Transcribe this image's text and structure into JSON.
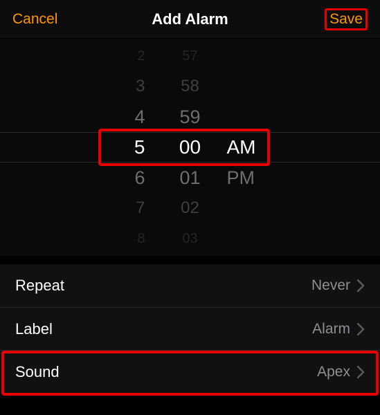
{
  "header": {
    "cancel": "Cancel",
    "title": "Add Alarm",
    "save": "Save"
  },
  "picker": {
    "hours": [
      "2",
      "3",
      "4",
      "5",
      "6",
      "7",
      "8"
    ],
    "minutes": [
      "57",
      "58",
      "59",
      "00",
      "01",
      "02",
      "03"
    ],
    "ampm_selected": "AM",
    "ampm_other": "PM"
  },
  "settings": {
    "repeat": {
      "label": "Repeat",
      "value": "Never"
    },
    "label": {
      "label": "Label",
      "value": "Alarm"
    },
    "sound": {
      "label": "Sound",
      "value": "Apex"
    }
  }
}
